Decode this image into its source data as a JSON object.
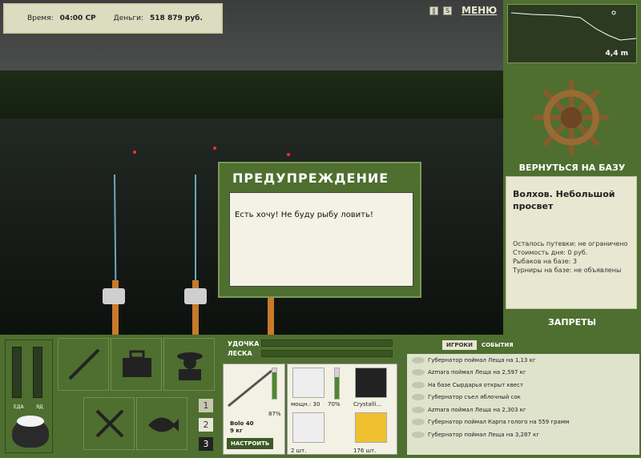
{
  "hud": {
    "time_label": "Время:",
    "time_value": "04:00 СР",
    "money_label": "Деньги:",
    "money_value": "518 879 руб."
  },
  "top_controls": {
    "pause_icon": "pause-icon",
    "sound_icon": "sound-icon",
    "menu_label": "МЕНЮ"
  },
  "depth": {
    "value": "4,4 m"
  },
  "base": {
    "back_label": "ВЕРНУТЬСЯ НА БАЗУ",
    "location": "Волхов. Небольшой просвет",
    "lines": [
      "Осталось путевки: не ограничено",
      "Стоимость дня: 0 руб.",
      "Рыбаков на базе: 3",
      "Турниры на базе: не объявлены"
    ],
    "bans_label": "ЗАПРЕТЫ"
  },
  "dialog": {
    "title": "ПРЕДУПРЕЖДЕНИЕ",
    "message": "Есть хочу! Не буду рыбу ловить!"
  },
  "meters": {
    "food_label": "ЕДА",
    "poison_label": "ЯД"
  },
  "slots": [
    "1",
    "2",
    "3"
  ],
  "rod": {
    "rod_label": "УДОЧКА",
    "line_label": "ЛЕСКА",
    "rod_name": "Bolo 40",
    "rod_weight": "9 кг",
    "rod_percent": "87%",
    "reel_power": "мощн.: 30",
    "reel_percent": "70%",
    "line_name": "Crystalli...",
    "hooks_count": "2 шт.",
    "bait_count": "176 шт.",
    "setup_label": "НАСТРОИТЬ"
  },
  "log": {
    "tab_players": "ИГРОКИ",
    "tab_events": "СОБЫТИЯ",
    "entries": [
      "Губернатор поймал Леща на 1,13 кг",
      "Azmara поймал Леща на 2,597 кг",
      "На базе Сырдарья открыт квест",
      "Губернатор съел яблочный сок",
      "Azmara поймал Леща на 2,303 кг",
      "Губернатор поймал Карпа голого на 559 грамм",
      "Губернатор поймал Леща на 3,287 кг"
    ]
  }
}
